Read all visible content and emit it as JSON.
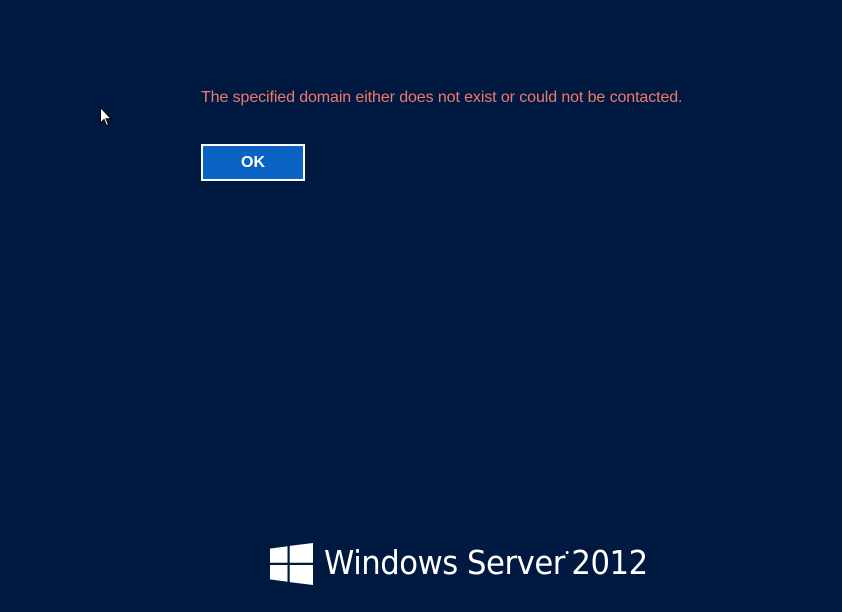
{
  "dialog": {
    "message": "The specified domain either does not exist or could not be contacted.",
    "ok_label": "OK"
  },
  "branding": {
    "product_name": "Windows Server",
    "version": "2012",
    "logo_icon": "windows-logo-icon"
  },
  "colors": {
    "background": "#001940",
    "message_text": "#f07a6a",
    "button_fill": "#0a63c2",
    "button_border": "#ffffff",
    "brand_text": "#ffffff"
  },
  "pointer": {
    "icon": "mouse-pointer-icon"
  }
}
